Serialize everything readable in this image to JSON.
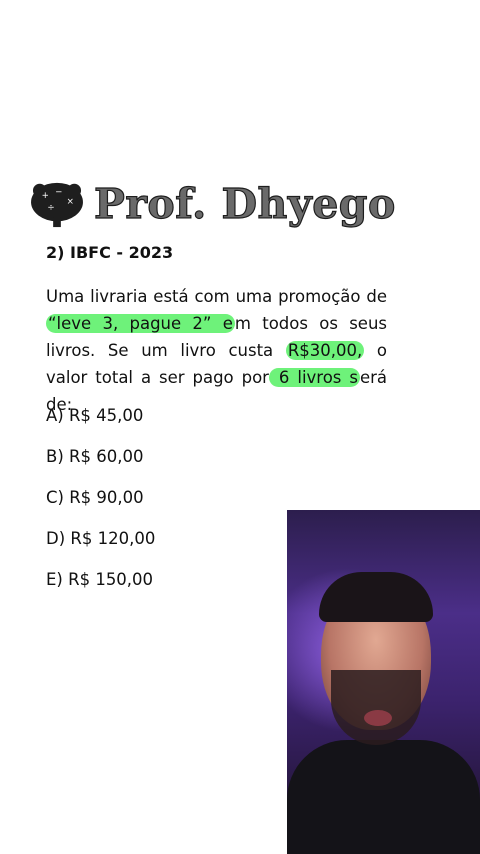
{
  "brand": {
    "title": "Prof. Dhyego",
    "icon": "brain-icon"
  },
  "question": {
    "header": "2) IBFC - 2023",
    "text_1": "Uma livraria está com uma promoção de ",
    "highlight_1": "“leve 3, pague 2” e",
    "text_2": "m todos os seus livros. Se um livro custa ",
    "highlight_2": "R$30,00,",
    "text_3": " o valor total a ser pago por",
    "highlight_3": " 6 livros s",
    "text_4": "erá de:"
  },
  "options": [
    "A) R$ 45,00",
    "B) R$ 60,00",
    "C) R$ 90,00",
    "D) R$ 120,00",
    "E) R$ 150,00"
  ],
  "colors": {
    "highlight": "#6ef27a",
    "brand_text": "#6a6a6a"
  }
}
